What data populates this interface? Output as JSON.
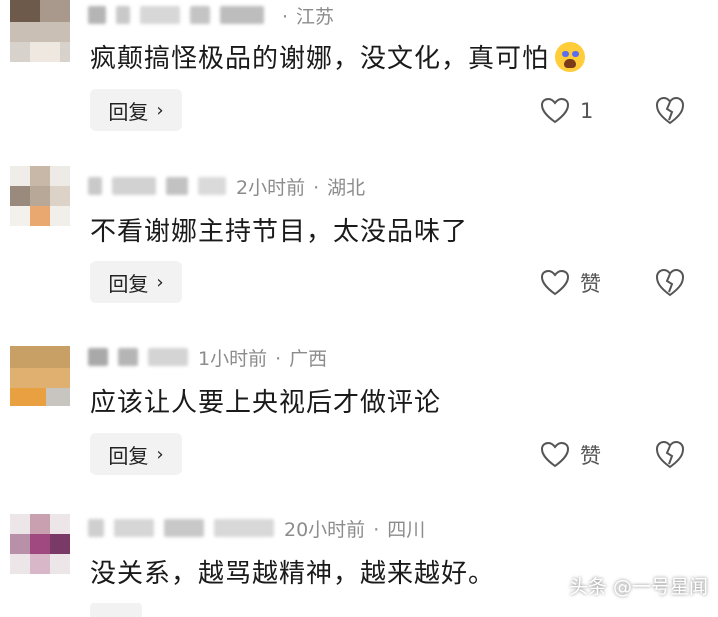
{
  "comments": [
    {
      "meta": "江苏",
      "time": "",
      "text": "疯颠搞怪极品的谢娜，没文化，真可怕",
      "emoji": "crying-face-icon",
      "reply_label": "回复",
      "like_label": "1"
    },
    {
      "meta": "湖北",
      "time": "2小时前",
      "text": "不看谢娜主持节目，太没品味了",
      "reply_label": "回复",
      "like_label": "赞"
    },
    {
      "meta": "广西",
      "time": "1小时前",
      "text": "应该让人要上央视后才做评论",
      "reply_label": "回复",
      "like_label": "赞"
    },
    {
      "meta": "四川",
      "time": "20小时前",
      "text": "没关系，越骂越精神，越来越好。",
      "reply_label": "",
      "like_label": ""
    }
  ],
  "watermark": "头条 @一号星闻",
  "colors": {
    "meta_gray": "#8c8c8c",
    "reply_bg": "#f2f2f2",
    "emoji_yellow": "#ffcc3a"
  }
}
